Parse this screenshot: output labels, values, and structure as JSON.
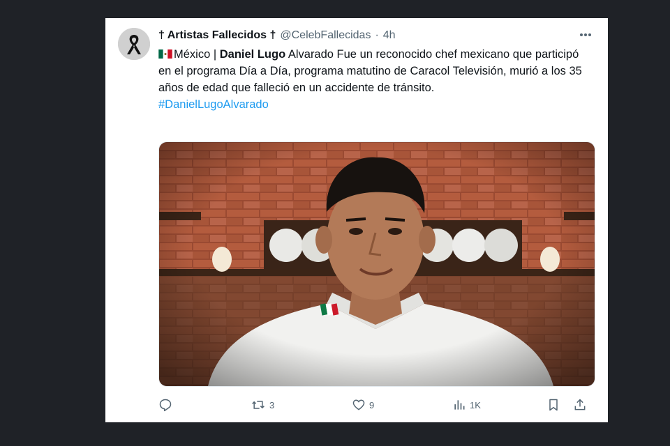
{
  "tweet": {
    "author_name": "† Artistas Fallecidos †",
    "handle": "@CelebFallecidas",
    "separator": "·",
    "time": "4h",
    "text": {
      "flag_icon": "mexico-flag-icon",
      "country": "México |",
      "name_bold": "Daniel Lugo",
      "rest": "Alvarado Fue un reconocido chef mexicano que participó en el programa Día a Día, programa matutino de Caracol Televisión, murió a los 35 años de edad que falleció en un accidente de tránsito.",
      "hashtag": "#DanielLugoAlvarado"
    },
    "media": {
      "description": "photo of smiling chef in white chef jacket with Mexico flag on collar, brick wall kitchen background"
    },
    "actions": {
      "reply_count": "",
      "retweet_count": "3",
      "like_count": "9",
      "views_count": "1K"
    }
  },
  "colors": {
    "background": "#1f2227",
    "card": "#ffffff",
    "text": "#0f1419",
    "muted": "#536471",
    "link": "#1d9bf0"
  }
}
